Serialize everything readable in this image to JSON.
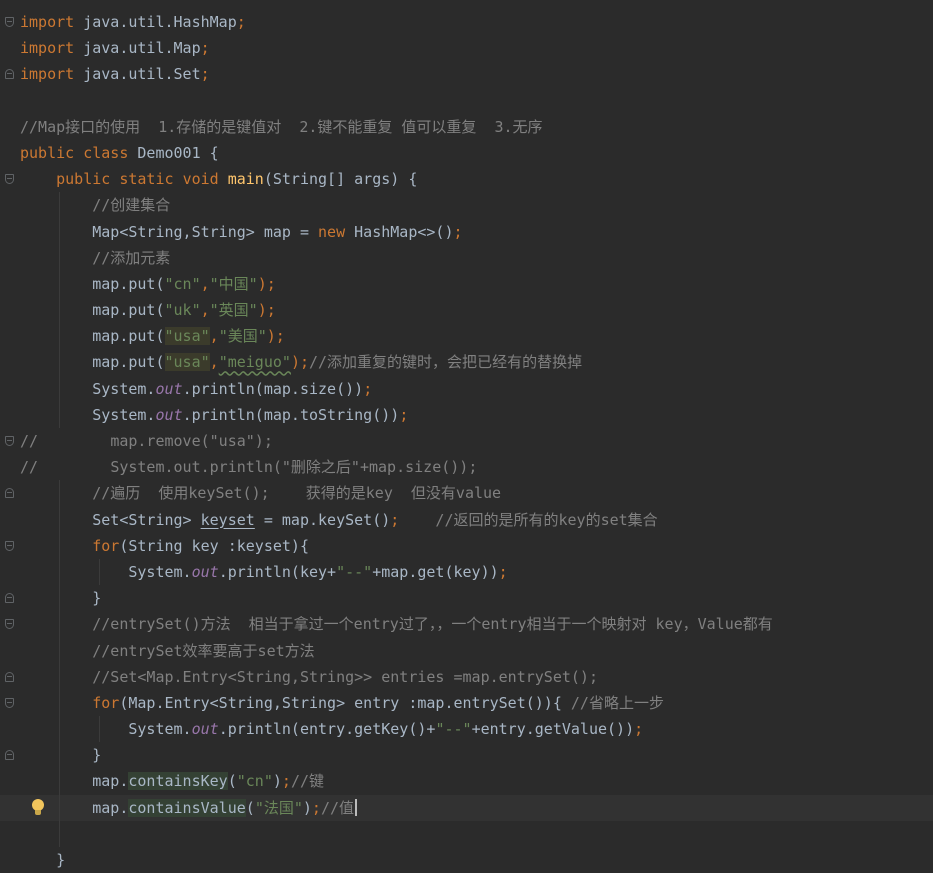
{
  "code": {
    "imports": [
      "import",
      "java.util.HashMap",
      "java.util.Map",
      "java.util.Set"
    ],
    "class_comment": "//Map接口的使用  1.存储的是键值对  2.键不能重复 值可以重复  3.无序",
    "class_decl": [
      "public",
      "class",
      "Demo001 {"
    ],
    "main_decl": [
      "public",
      "static",
      "void",
      "main",
      "(String[] args) {"
    ],
    "c_create": "//创建集合",
    "map_decl": [
      "Map<String,String> map = ",
      "new",
      " HashMap<>()",
      ";"
    ],
    "c_add": "//添加元素",
    "put1": [
      "map.put(",
      "\"cn\"",
      ",",
      "\"中国\"",
      ");"
    ],
    "put2": [
      "map.put(",
      "\"uk\"",
      ",",
      "\"英国\"",
      ");"
    ],
    "put3": [
      "map.put(",
      "\"usa\"",
      ",",
      "\"美国\"",
      ");"
    ],
    "put4": [
      "map.put(",
      "\"usa\"",
      ",",
      "\"meiguo\"",
      ");",
      "//添加重复的键时，会把已经有的替换掉"
    ],
    "print_size": [
      "System.",
      "out",
      ".println(map.size())",
      ";"
    ],
    "print_tostring": [
      "System.",
      "out",
      ".println(map.toString())",
      ";"
    ],
    "c_remove": [
      "//",
      "map.remove(\"usa\");"
    ],
    "c_print_remove": [
      "//",
      "System.out.println(\"删除之后\"+map.size());"
    ],
    "c_traverse": "//遍历  使用keySet();    获得的是key  但没有value",
    "keyset_decl": [
      "Set<String> ",
      "keyset",
      " = map.keySet()",
      ";",
      "    //返回的是所有的key的set集合"
    ],
    "for1": [
      "for",
      "(String key :keyset){"
    ],
    "for1_body": [
      "System.",
      "out",
      ".println(key+",
      "\"--\"",
      "+map.get(key))",
      ";"
    ],
    "close_brace": "}",
    "c_entryset": "//entrySet()方法  相当于拿过一个entry过了，，一个entry相当于一个映射对 key，Value都有",
    "c_efficiency": "//entrySet效率要高于set方法",
    "c_set_entry": "//Set<Map.Entry<String,String>> entries =map.entrySet();",
    "for2": [
      "for",
      "(Map.Entry<String,String> entry :map.entrySet()){ ",
      "//省略上一步"
    ],
    "for2_body": [
      "System.",
      "out",
      ".println(entry.getKey()+",
      "\"--\"",
      "+entry.getValue())",
      ";"
    ],
    "contains_key": [
      "map.",
      "containsKey",
      "(",
      "\"cn\"",
      ")",
      ";",
      "//键"
    ],
    "contains_value": [
      "map.",
      "containsValue",
      "(",
      "\"法国\"",
      ")",
      ";",
      "//值"
    ],
    "final_brace": "}"
  },
  "colors": {
    "background": "#2b2b2b",
    "keyword": "#cc7832",
    "string": "#6a8759",
    "comment": "#808080",
    "method": "#ffc66d",
    "static_field": "#9876aa",
    "text": "#a9b7c6"
  }
}
